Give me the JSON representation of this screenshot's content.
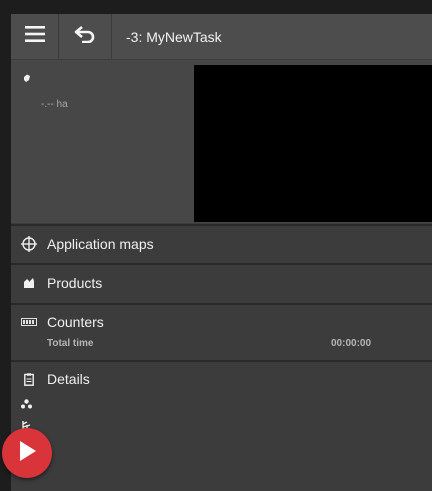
{
  "topbar": {
    "menu_icon": "hamburger-menu-icon",
    "back_icon": "undo-arrow-icon",
    "title": "-3: MyNewTask"
  },
  "info": {
    "icon": "pin-icon",
    "area": "-.-- ha"
  },
  "sections": {
    "application_maps": {
      "icon": "crosshair-icon",
      "label": "Application maps"
    },
    "products": {
      "icon": "product-icon",
      "label": "Products"
    },
    "counters": {
      "icon": "counter-icon",
      "label": "Counters",
      "sub_label": "Total time",
      "sub_value": "00:00:00"
    },
    "details": {
      "icon": "clipboard-icon",
      "label": "Details",
      "detail_icons": [
        "customer-icon",
        "farm-icon",
        "field-icon"
      ]
    }
  },
  "play_button": {
    "icon": "play-icon"
  },
  "colors": {
    "background": "#1d1d1d",
    "panel": "#3c3c3c",
    "topbar": "#4d4d4d",
    "map": "#000000",
    "play": "#d8343a"
  }
}
